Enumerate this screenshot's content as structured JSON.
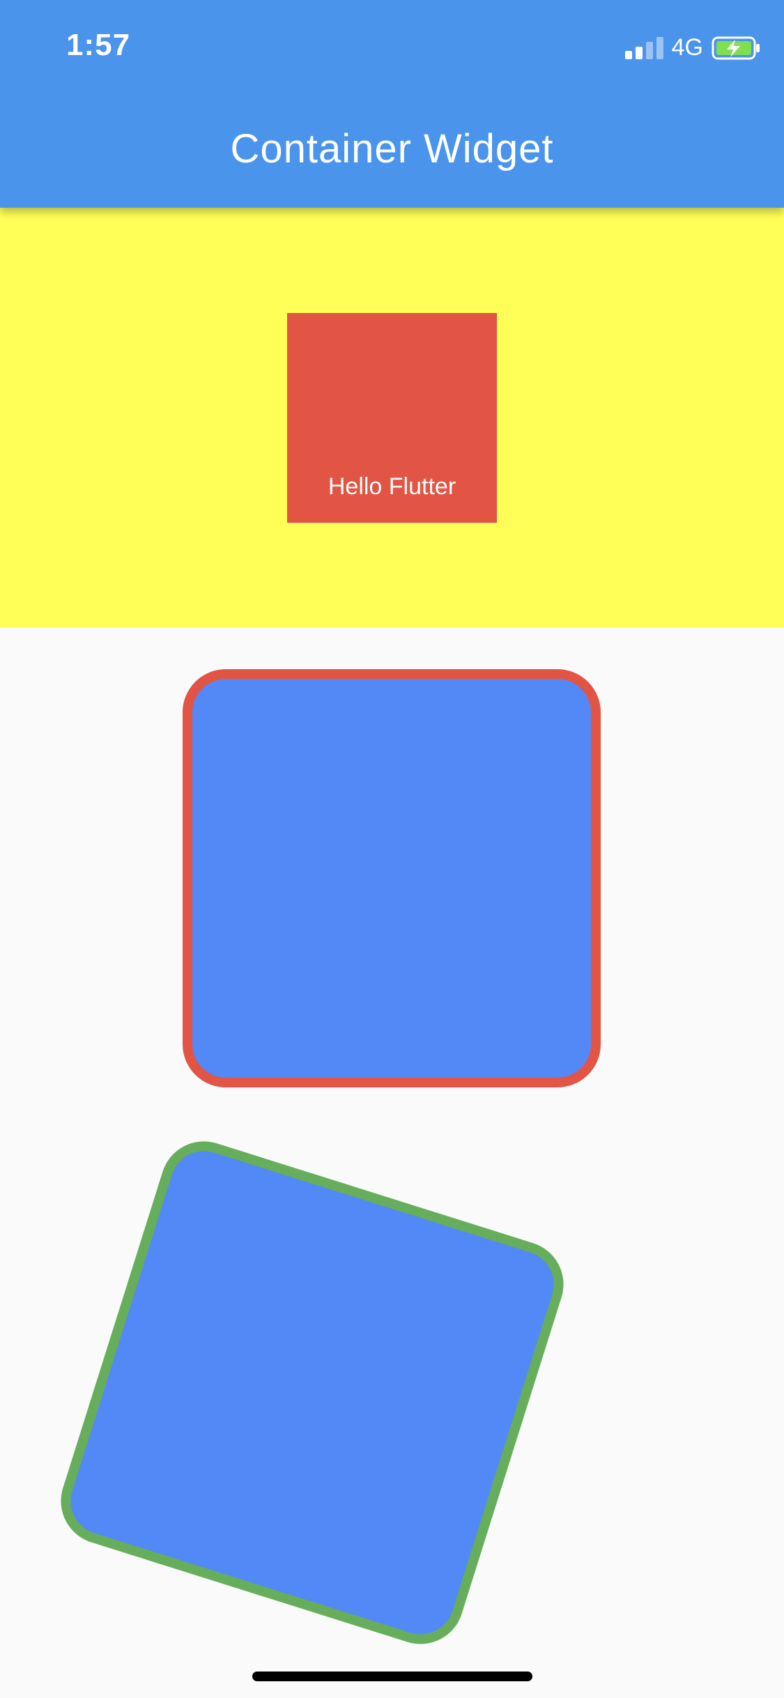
{
  "status_bar": {
    "time": "1:57",
    "network": "4G",
    "icons": [
      "signal-icon",
      "battery-charging-icon"
    ]
  },
  "app_bar": {
    "title": "Container Widget"
  },
  "red_box": {
    "label": "Hello Flutter"
  },
  "colors": {
    "app_bar": "#4a94ec",
    "yellow_section": "#ffff58",
    "red": "#e25444",
    "blue": "#5388f7",
    "green": "#66ae5c",
    "background": "#fafafa"
  }
}
